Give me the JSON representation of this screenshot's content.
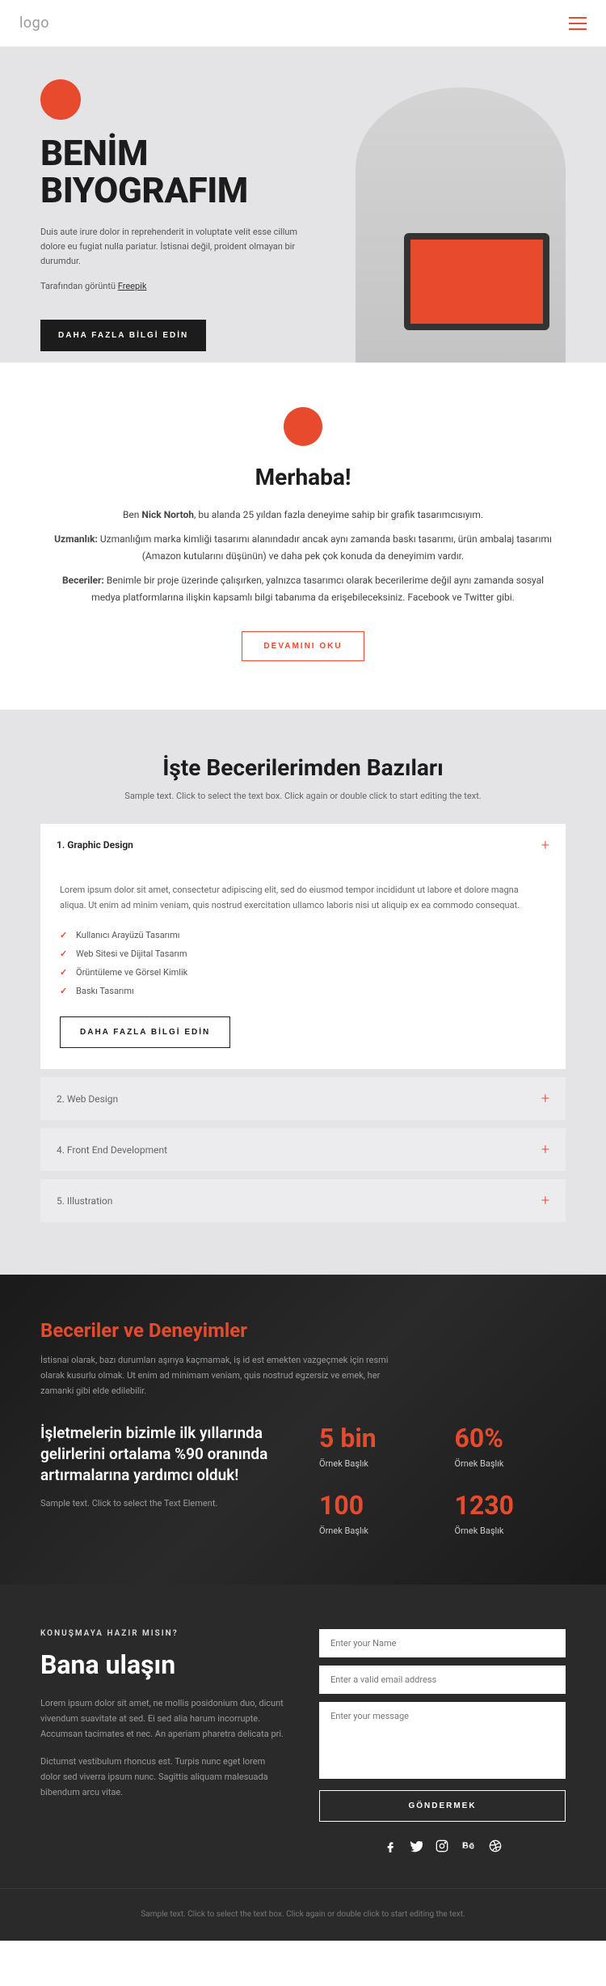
{
  "header": {
    "logo": "logo"
  },
  "hero": {
    "title": "BENİM biyografim",
    "desc": "Duis aute irure dolor in reprehenderit in voluptate velit esse cillum dolore eu fugiat nulla pariatur. İstisnai değil, proident olmayan bir durumdur.",
    "credit_prefix": "Tarafından görüntü ",
    "credit_link": "Freepik",
    "btn": "DAHA FAZLA BİLGİ EDİN"
  },
  "intro": {
    "title": "Merhaba!",
    "p1_prefix": "Ben ",
    "p1_name": "Nick Nortoh",
    "p1_suffix": ", bu alanda 25 yıldan fazla deneyime sahip bir grafik tasarımcısıyım.",
    "p2_label": "Uzmanlık:",
    "p2_text": " Uzmanlığım marka kimliği tasarımı alanındadır ancak aynı zamanda baskı tasarımı, ürün ambalaj tasarımı (Amazon kutularını düşünün) ve daha pek çok konuda da deneyimim vardır.",
    "p3_label": "Beceriler:",
    "p3_text": " Benimle bir proje üzerinde çalışırken, yalnızca tasarımcı olarak becerilerime değil aynı zamanda sosyal medya platformlarına ilişkin kapsamlı bilgi tabanıma da erişebileceksiniz. Facebook ve Twitter gibi.",
    "btn": "DEVAMINI OKU"
  },
  "skills": {
    "title": "İşte Becerilerimden Bazıları",
    "sub": "Sample text. Click to select the text box. Click again or double click to start editing the text.",
    "items": [
      {
        "label": "1. Graphic Design",
        "open": true
      },
      {
        "label": "2. Web Design",
        "open": false
      },
      {
        "label": "4. Front End Development",
        "open": false
      },
      {
        "label": "5. Illustration",
        "open": false
      }
    ],
    "body_text": "Lorem ipsum dolor sit amet, consectetur adipiscing elit, sed do eiusmod tempor incididunt ut labore et dolore magna aliqua. Ut enim ad minim veniam, quis nostrud exercitation ullamco laboris nisi ut aliquip ex ea commodo consequat.",
    "bullets": [
      "Kullanıcı Arayüzü Tasarımı",
      "Web Sitesi ve Dijital Tasarım",
      "Örüntüleme ve Görsel Kimlik",
      "Baskı Tasarımı"
    ],
    "btn": "DAHA FAZLA BİLGİ EDİN"
  },
  "exp": {
    "title": "Beceriler ve Deneyimler",
    "desc": "İstisnai olarak, bazı durumları aşırıya kaçmamak, iş id est emekten vazgeçmek için resmi olarak kusurlu olmak. Ut enim ad minimam veniam, quis nostrud egzersiz ve emek, her zamanki gibi elde edilebilir.",
    "left_title": "İşletmelerin bizimle ilk yıllarında gelirlerini ortalama %90 oranında artırmalarına yardımcı olduk!",
    "left_sub": "Sample text. Click to select the Text Element.",
    "stats": [
      {
        "val": "5 bin",
        "label": "Örnek Başlık"
      },
      {
        "val": "60%",
        "label": "Örnek Başlık"
      },
      {
        "val": "100",
        "label": "Örnek Başlık"
      },
      {
        "val": "1230",
        "label": "Örnek Başlık"
      }
    ]
  },
  "contact": {
    "eyebrow": "KONUŞMAYA HAZIR MISIN?",
    "title": "Bana ulaşın",
    "p1": "Lorem ipsum dolor sit amet, ne mollis posidonium duo, dicunt vivendum suavitate at sed. Ei sed alia harum incorrupte. Accumsan tacimates et nec. An aperiam pharetra delicata pri.",
    "p2": "Dictumst vestibulum rhoncus est. Turpis nunc eget lorem dolor sed viverra ipsum nunc. Sagittis aliquam malesuada bibendum arcu vitae.",
    "name_ph": "Enter your Name",
    "email_ph": "Enter a valid email address",
    "msg_ph": "Enter your message",
    "submit": "GÖNDERMEK"
  },
  "footer": {
    "text": "Sample text. Click to select the text box. Click again or double click to start editing the text."
  }
}
